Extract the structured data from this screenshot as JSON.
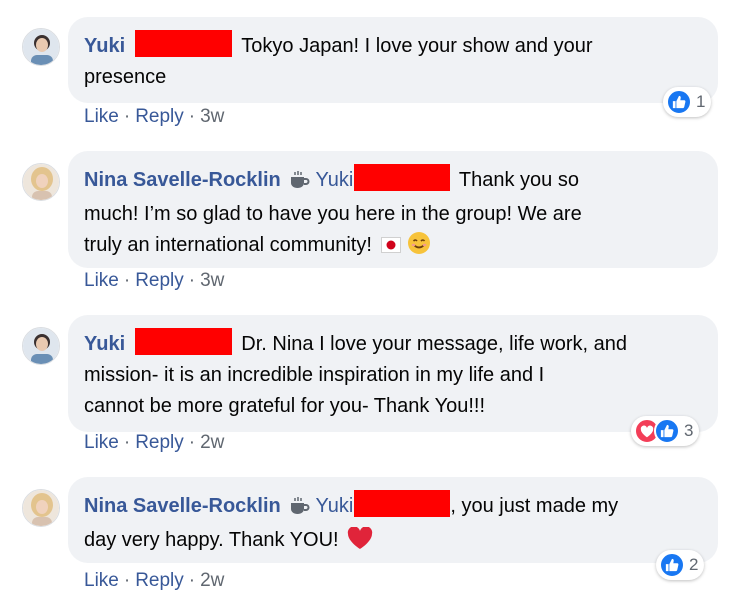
{
  "comments": [
    {
      "author": "Yuki",
      "mention": "",
      "text_line1": "Tokyo Japan! I love your show and your",
      "text_line2": "presence",
      "actions": {
        "like": "Like",
        "reply": "Reply",
        "age": "3w"
      },
      "reaction_count": "1"
    },
    {
      "author": "Nina Savelle-Rocklin",
      "mention": "Yuki",
      "text_line1": "Thank you so",
      "text_line2": "much! I’m so glad to have you here in the group! We are",
      "text_line3": "truly an international community!",
      "actions": {
        "like": "Like",
        "reply": "Reply",
        "age": "3w"
      }
    },
    {
      "author": "Yuki",
      "mention": "",
      "text_line1": "Dr. Nina I love your message, life work, and",
      "text_line2": "mission- it is an incredible inspiration in my life and I",
      "text_line3": "cannot be more grateful for you- Thank You!!!",
      "actions": {
        "like": "Like",
        "reply": "Reply",
        "age": "2w"
      },
      "reaction_count": "3"
    },
    {
      "author": "Nina Savelle-Rocklin",
      "mention": "Yuki",
      "text_line1": ", you just made my",
      "text_line2": "day very happy. Thank YOU!",
      "actions": {
        "like": "Like",
        "reply": "Reply",
        "age": "2w"
      },
      "reaction_count": "2"
    }
  ],
  "separator": "·",
  "colors": {
    "link": "#385898",
    "like": "#1877f2",
    "love": "#f33e58",
    "redaction": "#ff0000",
    "bubble": "#f0f2f5"
  }
}
